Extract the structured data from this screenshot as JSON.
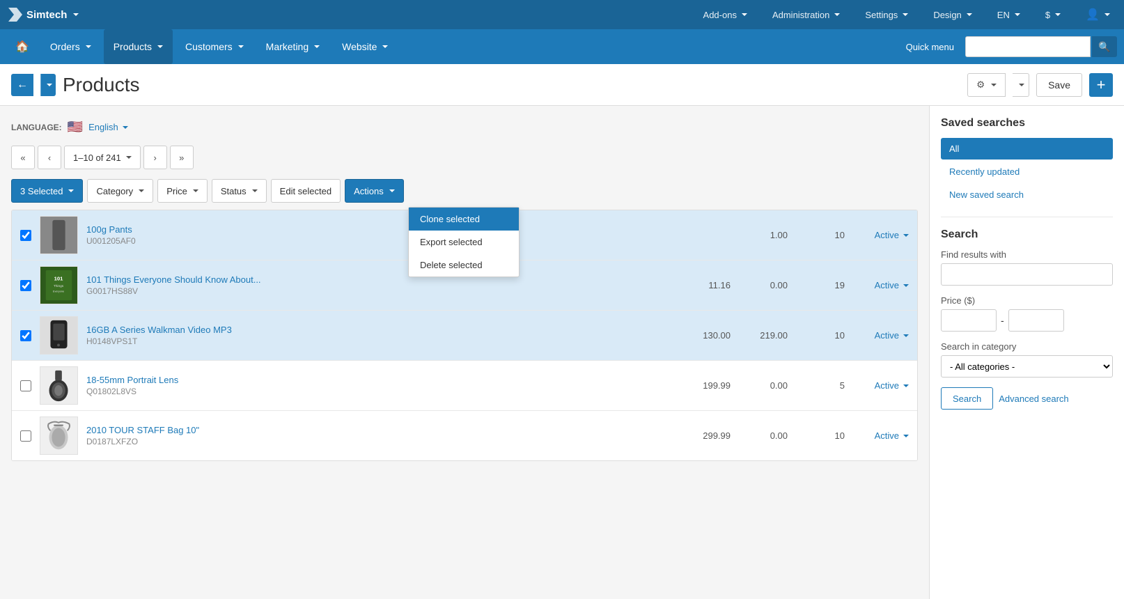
{
  "topNav": {
    "brand": "Simtech",
    "items": [
      {
        "label": "Add-ons",
        "id": "addons"
      },
      {
        "label": "Administration",
        "id": "administration"
      },
      {
        "label": "Settings",
        "id": "settings"
      },
      {
        "label": "Design",
        "id": "design"
      },
      {
        "label": "EN",
        "id": "en"
      },
      {
        "label": "$",
        "id": "currency"
      },
      {
        "label": "",
        "id": "user"
      }
    ]
  },
  "secNav": {
    "items": [
      {
        "label": "Orders",
        "id": "orders"
      },
      {
        "label": "Products",
        "id": "products",
        "active": true
      },
      {
        "label": "Customers",
        "id": "customers"
      },
      {
        "label": "Marketing",
        "id": "marketing"
      },
      {
        "label": "Website",
        "id": "website"
      }
    ],
    "quickMenu": "Quick menu",
    "searchPlaceholder": ""
  },
  "pageHeader": {
    "title": "Products",
    "saveLabel": "Save"
  },
  "language": {
    "label": "LANGUAGE:",
    "flag": "🇺🇸",
    "name": "English"
  },
  "pagination": {
    "current": "1–10 of 241",
    "prevFirst": "«",
    "prev": "‹",
    "next": "›",
    "nextLast": "»"
  },
  "toolbar": {
    "selectedLabel": "3 Selected",
    "categoryLabel": "Category",
    "priceLabel": "Price",
    "statusLabel": "Status",
    "editSelectedLabel": "Edit selected",
    "actionsLabel": "Actions"
  },
  "actionsDropdown": {
    "items": [
      {
        "label": "Clone selected",
        "id": "clone",
        "active": true
      },
      {
        "label": "Export selected",
        "id": "export"
      },
      {
        "label": "Delete selected",
        "id": "delete"
      }
    ]
  },
  "products": [
    {
      "id": 1,
      "name": "100g Pants",
      "code": "U001205AF0",
      "price": "",
      "listPrice": "1.00",
      "qty": "10",
      "status": "Active",
      "selected": true,
      "imgClass": "img-100g"
    },
    {
      "id": 2,
      "name": "101 Things Everyone Should Know About...",
      "code": "G0017HS88V",
      "price": "11.16",
      "listPrice": "0.00",
      "qty": "19",
      "status": "Active",
      "selected": true,
      "imgClass": "img-101"
    },
    {
      "id": 3,
      "name": "16GB A Series Walkman Video MP3",
      "code": "H0148VPS1T",
      "price": "130.00",
      "listPrice": "219.00",
      "qty": "10",
      "status": "Active",
      "selected": true,
      "imgClass": "img-16gb"
    },
    {
      "id": 4,
      "name": "18-55mm Portrait Lens",
      "code": "Q01802L8VS",
      "price": "199.99",
      "listPrice": "0.00",
      "qty": "5",
      "status": "Active",
      "selected": false,
      "imgClass": "img-lens"
    },
    {
      "id": 5,
      "name": "2010 TOUR STAFF Bag 10\"",
      "code": "D0187LXFZO",
      "price": "299.99",
      "listPrice": "0.00",
      "qty": "10",
      "status": "Active",
      "selected": false,
      "imgClass": "img-bag"
    }
  ],
  "sidebar": {
    "savedSearchesTitle": "Saved searches",
    "savedSearches": [
      {
        "label": "All",
        "active": true
      },
      {
        "label": "Recently updated",
        "active": false
      },
      {
        "label": "New saved search",
        "active": false
      }
    ],
    "searchTitle": "Search",
    "findResultsLabel": "Find results with",
    "priceLabel": "Price ($)",
    "searchInCategoryLabel": "Search in category",
    "categoryDefault": "- All categories -",
    "searchBtn": "Search",
    "advancedSearchBtn": "Advanced search"
  }
}
